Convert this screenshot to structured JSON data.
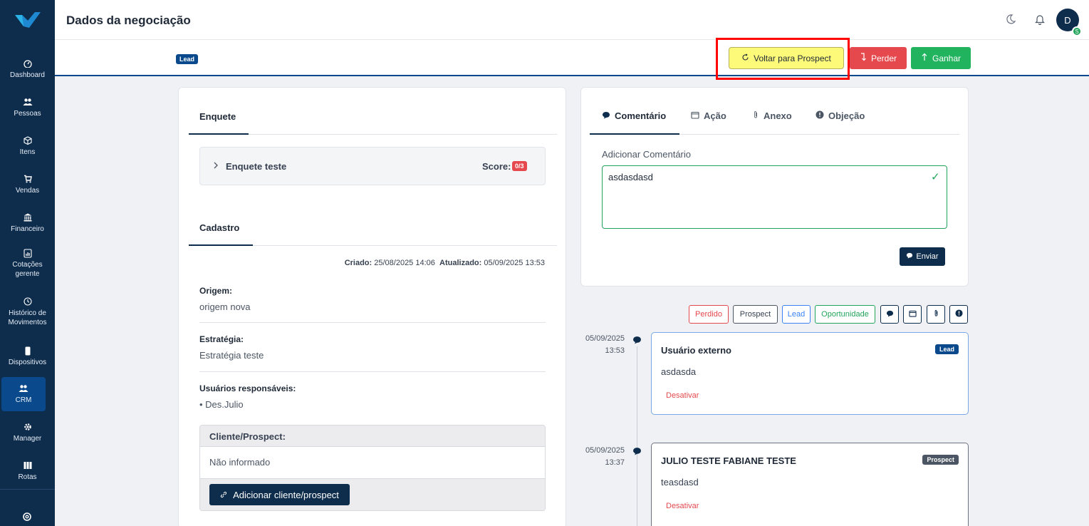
{
  "header": {
    "title": "Dados da negociação",
    "avatar_initial": "D",
    "avatar_badge": "S"
  },
  "sidebar": {
    "items": [
      {
        "label": "Dashboard",
        "icon": "dashboard-icon"
      },
      {
        "label": "Pessoas",
        "icon": "people-icon"
      },
      {
        "label": "Itens",
        "icon": "box-icon"
      },
      {
        "label": "Vendas",
        "icon": "cart-icon"
      },
      {
        "label": "Financeiro",
        "icon": "bank-icon"
      },
      {
        "label": "Cotações gerente",
        "icon": "report-icon"
      },
      {
        "label": "Histórico de Movimentos",
        "icon": "clock-icon"
      },
      {
        "label": "Dispositivos",
        "icon": "device-icon"
      },
      {
        "label": "CRM",
        "icon": "crm-icon"
      },
      {
        "label": "Manager",
        "icon": "gear-icon"
      },
      {
        "label": "Rotas",
        "icon": "columns-icon"
      }
    ]
  },
  "subbar": {
    "status_badge": "Lead",
    "voltar_label": "Voltar para Prospect",
    "perder_label": "Perder",
    "ganhar_label": "Ganhar"
  },
  "left": {
    "enquete_title": "Enquete",
    "enquete_item": "Enquete teste",
    "score_label": "Score:",
    "score_value": "0/3",
    "cadastro_title": "Cadastro",
    "criado_label": "Criado:",
    "criado_value": "25/08/2025 14:06",
    "atualizado_label": "Atualizado:",
    "atualizado_value": "05/09/2025 13:53",
    "origem_label": "Origem:",
    "origem_value": "origem nova",
    "estrategia_label": "Estratégia:",
    "estrategia_value": "Estratégia teste",
    "usuarios_label": "Usuários responsáveis:",
    "usuarios": [
      "Des.Julio"
    ],
    "cliente_header": "Cliente/Prospect:",
    "cliente_value": "Não informado",
    "add_cliente_label": "Adicionar cliente/prospect"
  },
  "right": {
    "tabs": [
      "Comentário",
      "Ação",
      "Anexo",
      "Objeção"
    ],
    "comment_label": "Adicionar Comentário",
    "comment_value": "asdasdasd",
    "enviar_label": "Enviar"
  },
  "filters": [
    "Perdido",
    "Prospect",
    "Lead",
    "Oportunidade"
  ],
  "timeline": [
    {
      "date": "05/09/2025",
      "time": "13:53",
      "user": "Usuário externo",
      "text": "asdasda",
      "action": "Desativar",
      "badge": "Lead",
      "badge_color": "#0a4a8c"
    },
    {
      "date": "05/09/2025",
      "time": "13:37",
      "user": "JULIO TESTE FABIANE TESTE",
      "text": "teasdasd",
      "action": "Desativar",
      "badge": "Prospect",
      "badge_color": "#4b5563"
    }
  ]
}
